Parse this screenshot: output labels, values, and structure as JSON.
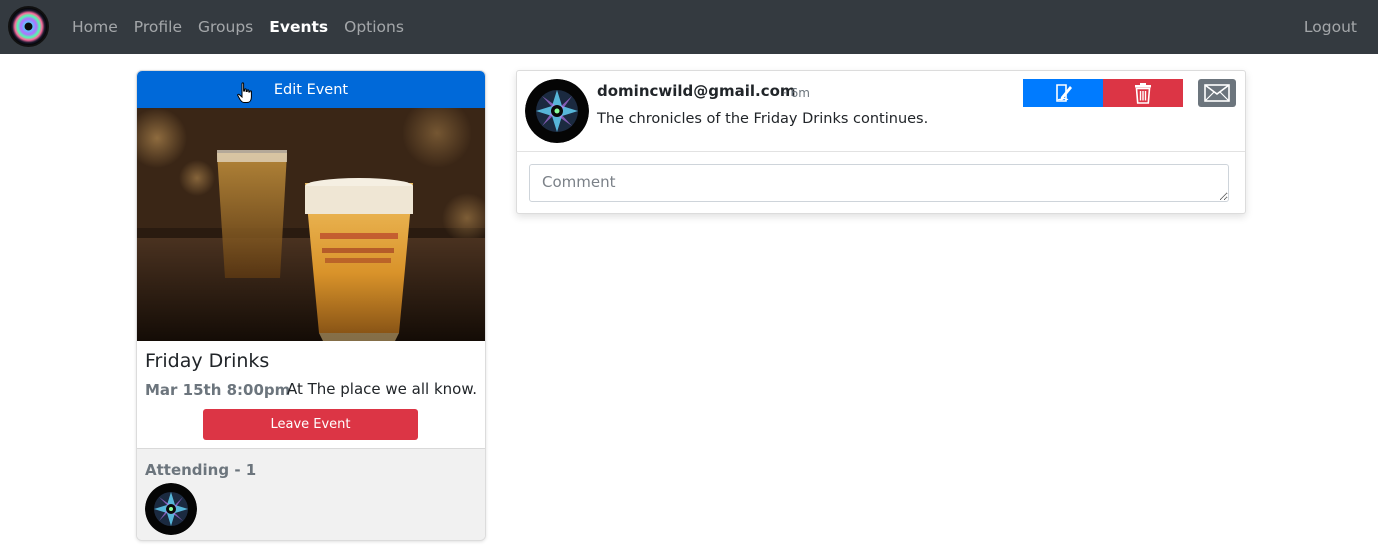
{
  "nav": {
    "links": [
      {
        "label": "Home",
        "active": false
      },
      {
        "label": "Profile",
        "active": false
      },
      {
        "label": "Groups",
        "active": false
      },
      {
        "label": "Events",
        "active": true
      },
      {
        "label": "Options",
        "active": false
      }
    ],
    "logout_label": "Logout"
  },
  "event": {
    "edit_label": "Edit Event",
    "title": "Friday Drinks",
    "date": "Mar 15th 8:00pm",
    "location": "At The place we all know.",
    "leave_label": "Leave Event",
    "attending_label": "Attending - 1"
  },
  "post": {
    "author": "domincwild@gmail.com",
    "time": "· 6m",
    "text": "The chronicles of the Friday Drinks continues.",
    "comment_placeholder": "Comment"
  },
  "icons": {
    "edit": "pencil-sign-icon",
    "delete": "trash-icon",
    "mail": "envelope-icon",
    "cursor": "hand-pointer-icon"
  },
  "colors": {
    "navbar": "#343a40",
    "primary": "#007bff",
    "danger": "#dc3545",
    "secondary": "#6c757d"
  }
}
